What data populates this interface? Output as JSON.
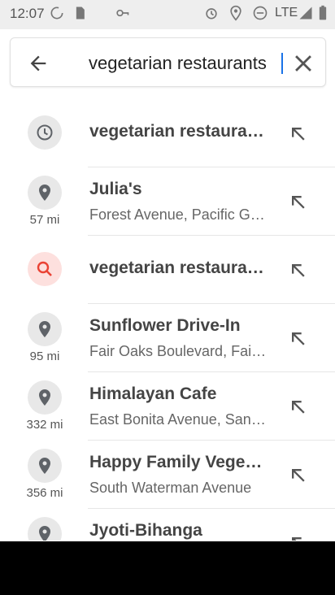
{
  "status_bar": {
    "time": "12:07",
    "network": "LTE",
    "icons": [
      "data-saver-icon",
      "sd-card-icon",
      "vpn-key-icon",
      "alarm-icon",
      "location-icon",
      "do-not-disturb-icon",
      "signal-icon",
      "battery-icon"
    ]
  },
  "search": {
    "query": "vegetarian restaurants",
    "back_icon": "back-arrow-icon",
    "clear_icon": "close-icon"
  },
  "suggestions": [
    {
      "icon": "history-icon",
      "title": "vegetarian restaurants",
      "subtitle": "",
      "distance": ""
    },
    {
      "icon": "place-icon",
      "title": "Julia's",
      "subtitle": "Forest Avenue, Pacific Grove",
      "distance": "57 mi"
    },
    {
      "icon": "search-icon",
      "title": "vegetarian restaurants",
      "subtitle": "",
      "distance": ""
    },
    {
      "icon": "place-icon",
      "title": "Sunflower Drive-In",
      "subtitle": "Fair Oaks Boulevard, Fair Oaks",
      "distance": "95 mi"
    },
    {
      "icon": "place-icon",
      "title": "Himalayan Cafe",
      "subtitle": "East Bonita Avenue, San Dimas",
      "distance": "332 mi"
    },
    {
      "icon": "place-icon",
      "title": "Happy Family Vegetarian",
      "subtitle": "South Waterman Avenue",
      "distance": "356 mi"
    },
    {
      "icon": "place-icon",
      "title": "Jyoti-Bihanga",
      "subtitle": "",
      "distance": ""
    }
  ],
  "colors": {
    "accent": "#1a73e8",
    "search_icon_red": "#ea4335",
    "icon_gray": "#5f6368"
  }
}
